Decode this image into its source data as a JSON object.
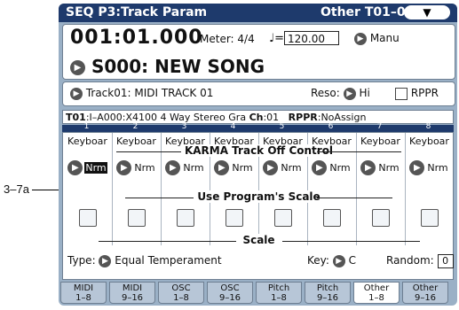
{
  "callout_label": "3–7a",
  "title": "SEQ P3:Track Param",
  "title_right": "Other T01–08",
  "menu_glyph": "▼",
  "location": "001:01.000",
  "meter": "Meter: 4/4",
  "tempo_label": "♩=",
  "tempo_value": "120.00",
  "tempo_mode": "Manu",
  "song_name": "S000: NEW SONG",
  "track_label": "Track01: MIDI TRACK 01",
  "reso_label": "Reso:",
  "reso_value": "Hi",
  "rppr_label": "RPPR",
  "info": {
    "track": "T01",
    "program": ":I–A000:X4100 4 Way Stereo Gra",
    "ch_label": "Ch",
    "ch_value": ":01",
    "rppr_label": "RPPR",
    "rppr_value": ":NoAssign"
  },
  "track_numbers": [
    "1",
    "2",
    "3",
    "4",
    "5",
    "6",
    "7",
    "8"
  ],
  "track_names": [
    "Keyboar",
    "Keyboar",
    "Keyboar",
    "Keyboar",
    "Keyboar",
    "Keyboar",
    "Keyboar",
    "Keyboar"
  ],
  "karma_header": "KARMA Track Off Control",
  "karma_values": [
    "Nrm",
    "Nrm",
    "Nrm",
    "Nrm",
    "Nrm",
    "Nrm",
    "Nrm",
    "Nrm"
  ],
  "use_prog_header": "Use Program's Scale",
  "scale_header": "Scale",
  "scale": {
    "type_label": "Type:",
    "type_value": "Equal Temperament",
    "key_label": "Key:",
    "key_value": "C",
    "random_label": "Random:",
    "random_value": "0"
  },
  "tabs": [
    {
      "line1": "MIDI",
      "line2": "1–8"
    },
    {
      "line1": "MIDI",
      "line2": "9–16"
    },
    {
      "line1": "OSC",
      "line2": "1–8"
    },
    {
      "line1": "OSC",
      "line2": "9–16"
    },
    {
      "line1": "Pitch",
      "line2": "1–8"
    },
    {
      "line1": "Pitch",
      "line2": "9–16"
    },
    {
      "line1": "Other",
      "line2": "1–8"
    },
    {
      "line1": "Other",
      "line2": "9–16"
    }
  ],
  "active_tab_index": 6,
  "colors": {
    "titlebar": "#1e3a6c",
    "screen_bg": "#9ab0c6",
    "tab_bg": "#b7c6d7"
  }
}
